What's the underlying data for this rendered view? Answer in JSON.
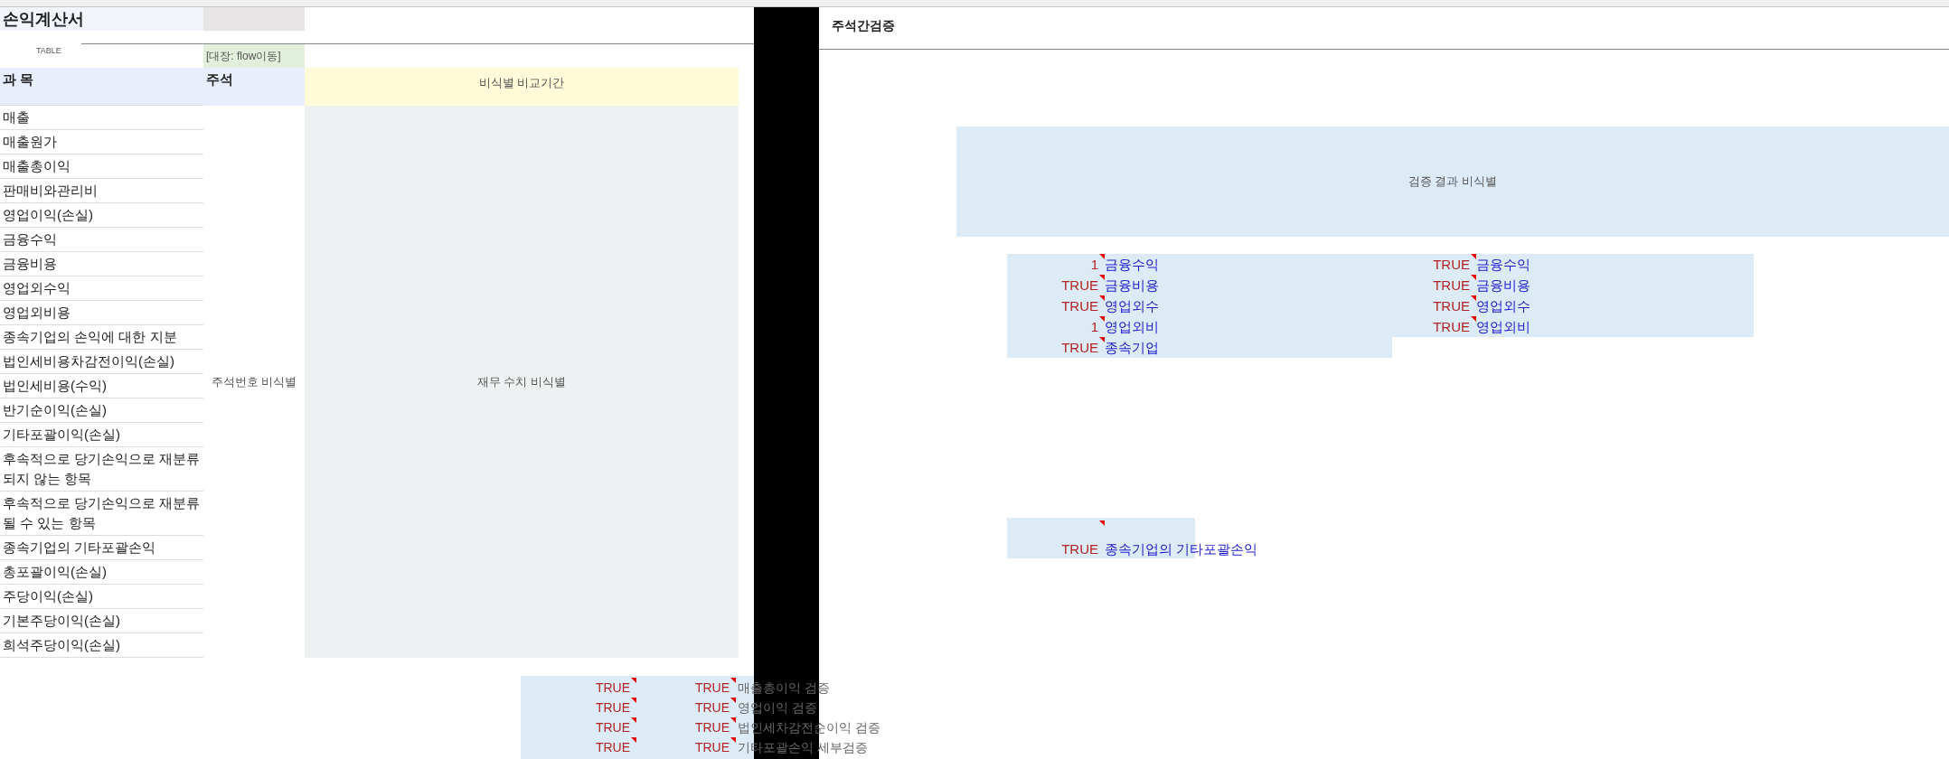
{
  "sheet_title": "손익계산서",
  "table_label": "TABLE",
  "link_cell": "[대장: flow이동]",
  "headers": {
    "account": "과 목",
    "note": "주석",
    "period": "비식별 비교기간"
  },
  "accounts": [
    "매출",
    "매출원가",
    "매출총이익",
    "판매비와관리비",
    "영업이익(손실)",
    "금융수익",
    "금융비용",
    "영업외수익",
    "영업외비용",
    "종속기업의 손익에 대한 지분",
    "법인세비용차감전이익(손실)",
    "법인세비용(수익)",
    "반기순이익(손실)",
    "기타포괄이익(손실)",
    "후속적으로 당기손익으로 재분류되지 않는 항목",
    "후속적으로 당기손익으로 재분류될 수 있는 항목",
    "종속기업의 기타포괄손익",
    "총포괄이익(손실)",
    "주당이익(손실)",
    "기본주당이익(손실)",
    "희석주당이익(손실)"
  ],
  "note_placeholder": "주석번호 비식별",
  "figures_placeholder": "재무 수치 비식별",
  "checks": [
    {
      "col_1": "TRUE",
      "col_2": "TRUE",
      "label": "매출총이익 검증"
    },
    {
      "col_1": "TRUE",
      "col_2": "TRUE",
      "label": "영업이익 검증"
    },
    {
      "col_1": "TRUE",
      "col_2": "TRUE",
      "label": "법인세차감전순이익 검증"
    },
    {
      "col_1": "TRUE",
      "col_2": "TRUE",
      "label": "기타포괄손익 세부검증"
    }
  ],
  "right": {
    "title": "주석간검증",
    "result_banner": "검증 결과 비식별",
    "groups": [
      {
        "rows": [
          {
            "result": "1",
            "item": "금융수익"
          },
          {
            "result": "TRUE",
            "item": "금융비용"
          },
          {
            "result": "TRUE",
            "item": "영업외수"
          },
          {
            "result": "1",
            "item": "영업외비"
          },
          {
            "result": "TRUE",
            "item": "종속기업"
          }
        ]
      },
      {
        "rows": [
          {
            "result": "TRUE",
            "item": "금융수익"
          },
          {
            "result": "TRUE",
            "item": "금융비용"
          },
          {
            "result": "TRUE",
            "item": "영업외수"
          },
          {
            "result": "TRUE",
            "item": "영업외비"
          }
        ]
      }
    ],
    "single": {
      "value": "TRUE",
      "label": "종속기업의 기타포괄손익"
    }
  }
}
